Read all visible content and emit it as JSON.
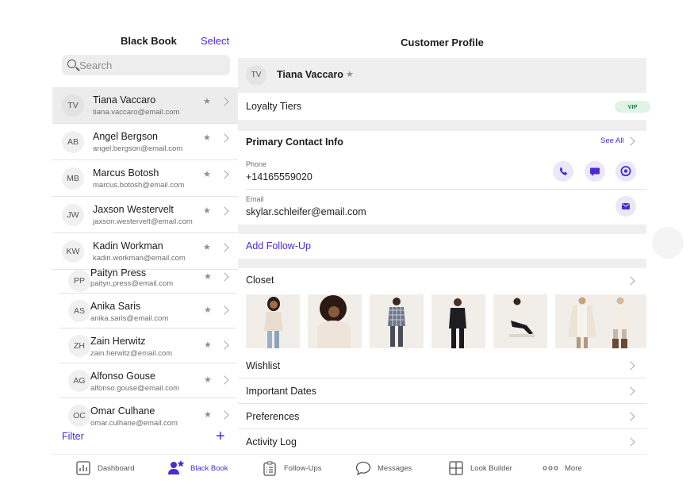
{
  "left": {
    "title": "Black Book",
    "select_label": "Select",
    "search_placeholder": "Search",
    "contacts": [
      {
        "initials": "TV",
        "name": "Tiana Vaccaro",
        "email": "tiana.vaccaro@email.com"
      },
      {
        "initials": "AB",
        "name": "Angel Bergson",
        "email": "angel.bergson@email.com"
      },
      {
        "initials": "MB",
        "name": "Marcus Botosh",
        "email": "marcus.botosh@email.com"
      },
      {
        "initials": "JW",
        "name": "Jaxson Westervelt",
        "email": "jaxson.westervelt@email.com"
      },
      {
        "initials": "KW",
        "name": "Kadin Workman",
        "email": "kadin.workman@email.com"
      },
      {
        "initials": "PP",
        "name": "Paityn Press",
        "email": "paityn.press@email.com"
      },
      {
        "initials": "AS",
        "name": "Anika Saris",
        "email": "anika.saris@email.com"
      },
      {
        "initials": "ZH",
        "name": "Zain Herwitz",
        "email": "zain.herwitz@email.com"
      },
      {
        "initials": "AG",
        "name": "Alfonso Gouse",
        "email": "alfonso.gouse@email.com"
      },
      {
        "initials": "OC",
        "name": "Omar Culhane",
        "email": "omar.culhane@email.com"
      }
    ],
    "filter_label": "Filter",
    "add_label": "+"
  },
  "right": {
    "title": "Customer Profile",
    "profile": {
      "initials": "TV",
      "name": "Tiana Vaccaro"
    },
    "loyalty_label": "Loyalty Tiers",
    "loyalty_badge": "VIP",
    "contact_header": "Primary Contact Info",
    "see_all": "See All",
    "phone_label": "Phone",
    "phone_value": "+14165559020",
    "email_label": "Email",
    "email_value": "skylar.schleifer@email.com",
    "add_followup": "Add Follow-Up",
    "closet_label": "Closet",
    "rows": [
      "Wishlist",
      "Important Dates",
      "Preferences",
      "Activity Log"
    ]
  },
  "tabs": [
    {
      "label": "Dashboard",
      "icon": "dashboard-icon"
    },
    {
      "label": "Black Book",
      "icon": "black-book-icon",
      "active": true
    },
    {
      "label": "Follow-Ups",
      "icon": "clipboard-icon"
    },
    {
      "label": "Messages",
      "icon": "chat-bubble-icon"
    },
    {
      "label": "Look Builder",
      "icon": "grid-icon"
    },
    {
      "label": "More",
      "icon": "more-dots-icon"
    }
  ],
  "colors": {
    "accent": "#4b2bd1",
    "vip_bg": "#dff3e6",
    "vip_text": "#2e7d4a",
    "separator": "#efefef"
  }
}
